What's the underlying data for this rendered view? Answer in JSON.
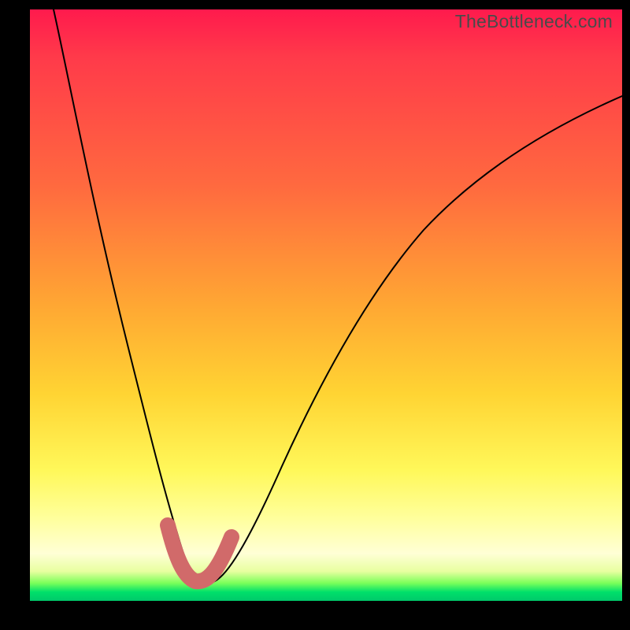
{
  "watermark": {
    "text": "TheBottleneck.com"
  },
  "colors": {
    "gradient_top": "#ff1a4d",
    "gradient_mid_orange": "#ffa733",
    "gradient_yellow": "#fff85a",
    "gradient_pale": "#ffffd6",
    "gradient_green": "#00c86a",
    "curve_stroke": "#000000",
    "nub_stroke": "#d16a6a",
    "background": "#000000"
  },
  "chart_data": {
    "type": "line",
    "title": "",
    "xlabel": "",
    "ylabel": "",
    "xlim": [
      0,
      100
    ],
    "ylim": [
      0,
      100
    ],
    "series": [
      {
        "name": "bottleneck-curve",
        "x": [
          4,
          8,
          12,
          16,
          20,
          23,
          25,
          27,
          30,
          34,
          40,
          48,
          56,
          64,
          72,
          80,
          88,
          96,
          100
        ],
        "y": [
          100,
          80,
          60,
          42,
          26,
          14,
          6,
          3,
          3,
          6,
          16,
          32,
          46,
          58,
          67,
          74,
          79,
          83,
          85
        ]
      }
    ],
    "highlight_segment": {
      "name": "min-region",
      "x": [
        23,
        25,
        27,
        30,
        33
      ],
      "y": [
        12,
        5,
        3,
        3,
        7
      ]
    },
    "notes": "V-shaped curve over vertical red→green gradient; salmon thick stroke marks the trough."
  }
}
